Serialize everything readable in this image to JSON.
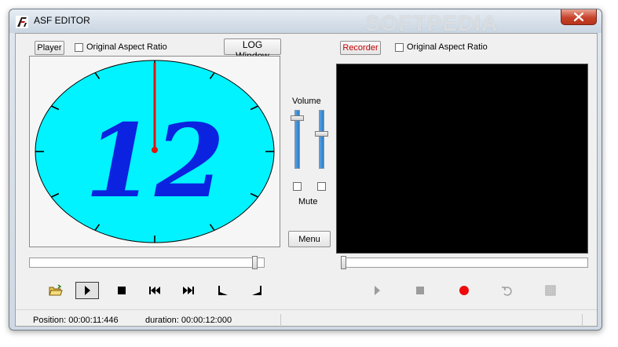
{
  "window": {
    "title": "ASF EDITOR",
    "watermark": "SOFTPEDIA"
  },
  "player": {
    "label": "Player",
    "aspect_ratio_label": "Original Aspect Ratio",
    "log_button": "LOG Window",
    "video_text": "12",
    "colors": {
      "clock_face": "#00f3ff",
      "numeral": "#0b22e0",
      "hand": "#e0150e"
    },
    "seek_progress": 0.97
  },
  "volume": {
    "label": "Volume",
    "mute_label": "Mute",
    "menu_button": "Menu",
    "left_level": 0.9,
    "right_level": 0.6
  },
  "recorder": {
    "label": "Recorder",
    "aspect_ratio_label": "Original Aspect Ratio",
    "label_color": "#c00000",
    "seek_progress": 0.0
  },
  "transport": {
    "player_controls": [
      "open-folder-icon",
      "play-icon",
      "stop-icon",
      "skip-back-icon",
      "skip-forward-icon",
      "mark-in-icon",
      "mark-out-icon"
    ],
    "recorder_controls": [
      "play-icon",
      "stop-icon",
      "record-icon",
      "undo-icon",
      "grid-icon"
    ]
  },
  "status": {
    "position": "Position: 00:00:11:446",
    "duration": "duration: 00:00:12:000"
  }
}
